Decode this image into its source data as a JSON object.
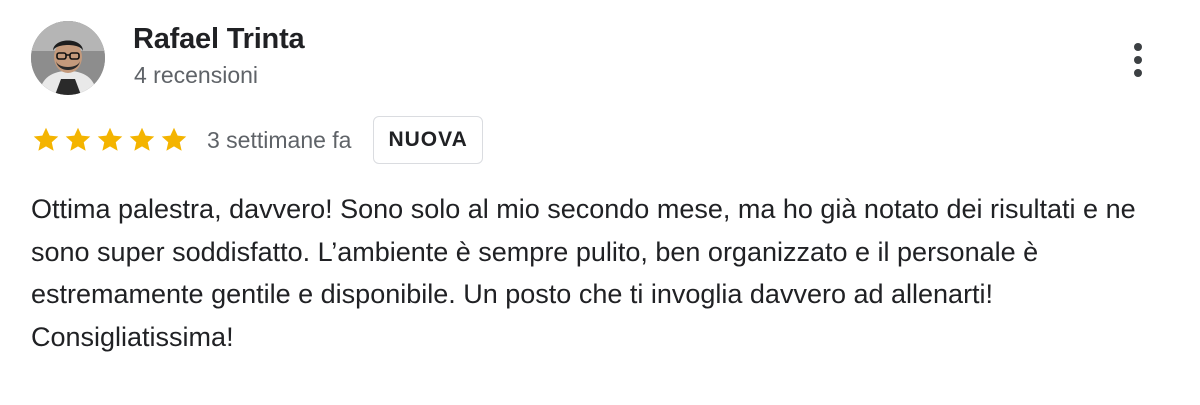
{
  "review": {
    "author": {
      "name": "Rafael Trinta",
      "meta": "4 recensioni",
      "avatar_icon": "user-photo"
    },
    "more_icon": "more-vert-icon",
    "rating": {
      "value": 5,
      "max": 5,
      "star_color": "#f4b400",
      "star_icon": "star-icon"
    },
    "date": "3 settimane fa",
    "badge": "NUOVA",
    "text": "Ottima palestra, davvero! Sono solo al mio secondo mese, ma ho già notato dei risultati e ne sono super soddisfatto. L’ambiente è sempre pulito, ben organizzato e il personale è estremamente gentile e disponibile. Un posto che ti invoglia davvero ad allenarti! Consigliatissima!"
  }
}
